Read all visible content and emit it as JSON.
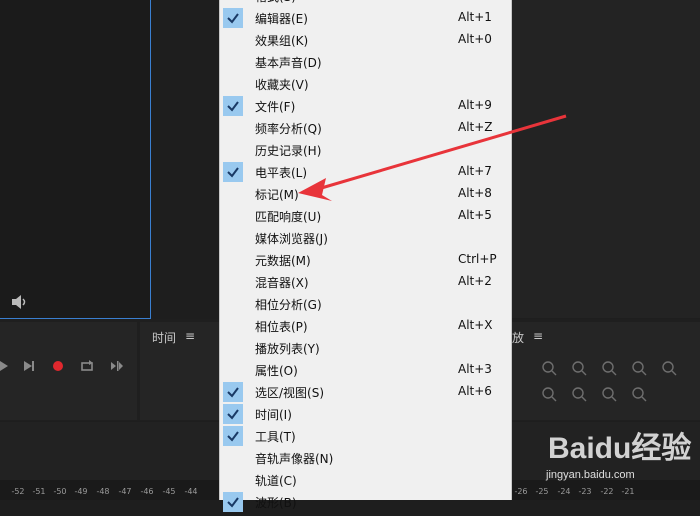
{
  "panels": {
    "time_title": "时间",
    "zoom_title": "放",
    "hamburger": "≡"
  },
  "menu": {
    "items": [
      {
        "label": "格式(S)",
        "shortcut": "",
        "checked": false
      },
      {
        "label": "编辑器(E)",
        "shortcut": "Alt+1",
        "checked": true
      },
      {
        "label": "效果组(K)",
        "shortcut": "Alt+0",
        "checked": false
      },
      {
        "label": "基本声音(D)",
        "shortcut": "",
        "checked": false
      },
      {
        "label": "收藏夹(V)",
        "shortcut": "",
        "checked": false
      },
      {
        "label": "文件(F)",
        "shortcut": "Alt+9",
        "checked": true
      },
      {
        "label": "频率分析(Q)",
        "shortcut": "Alt+Z",
        "checked": false
      },
      {
        "label": "历史记录(H)",
        "shortcut": "",
        "checked": false
      },
      {
        "label": "电平表(L)",
        "shortcut": "Alt+7",
        "checked": true
      },
      {
        "label": "标记(M)",
        "shortcut": "Alt+8",
        "checked": false
      },
      {
        "label": "匹配响度(U)",
        "shortcut": "Alt+5",
        "checked": false
      },
      {
        "label": "媒体浏览器(J)",
        "shortcut": "",
        "checked": false
      },
      {
        "label": "元数据(M)",
        "shortcut": "Ctrl+P",
        "checked": false
      },
      {
        "label": "混音器(X)",
        "shortcut": "Alt+2",
        "checked": false
      },
      {
        "label": "相位分析(G)",
        "shortcut": "",
        "checked": false
      },
      {
        "label": "相位表(P)",
        "shortcut": "Alt+X",
        "checked": false
      },
      {
        "label": "播放列表(Y)",
        "shortcut": "",
        "checked": false
      },
      {
        "label": "属性(O)",
        "shortcut": "Alt+3",
        "checked": false
      },
      {
        "label": "选区/视图(S)",
        "shortcut": "Alt+6",
        "checked": true
      },
      {
        "label": "时间(I)",
        "shortcut": "",
        "checked": true
      },
      {
        "label": "工具(T)",
        "shortcut": "",
        "checked": true
      },
      {
        "label": "音轨声像器(N)",
        "shortcut": "",
        "checked": false
      },
      {
        "label": "轨道(C)",
        "shortcut": "",
        "checked": false
      },
      {
        "label": "波形(B)",
        "shortcut": "",
        "checked": true
      }
    ]
  },
  "ruler": {
    "ticks": [
      "-52",
      "-51",
      "-50",
      "-49",
      "-48",
      "-47",
      "-46",
      "-45",
      "-44",
      "-26",
      "-25",
      "-24",
      "-23",
      "-22",
      "-21"
    ]
  },
  "watermark": {
    "brand": "Baidu经验",
    "url": "jingyan.baidu.com"
  },
  "colors": {
    "menu_bg": "#f0f0f0",
    "check_bg": "#99c9ef",
    "record": "#e0282e",
    "arrow": "#e8343a",
    "panel_border": "#3a7fd0"
  }
}
